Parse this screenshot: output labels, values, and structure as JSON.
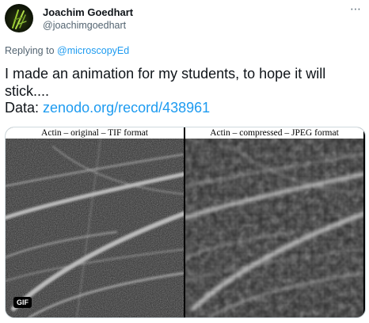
{
  "tweet": {
    "author_name": "Joachim Goedhart",
    "author_handle": "@joachimgoedhart",
    "reply_prefix": "Replying to ",
    "reply_target": "@microscopyEd",
    "text_line1": "I made an animation for my students, to hope it will",
    "text_line2": "stick....",
    "data_prefix": "Data: ",
    "data_link": "zenodo.org/record/438961",
    "more_icon": "⋯"
  },
  "media": {
    "left_title": "Actin – original – TIF format",
    "right_title": "Actin – compressed – JPEG format",
    "badge": "GIF"
  }
}
